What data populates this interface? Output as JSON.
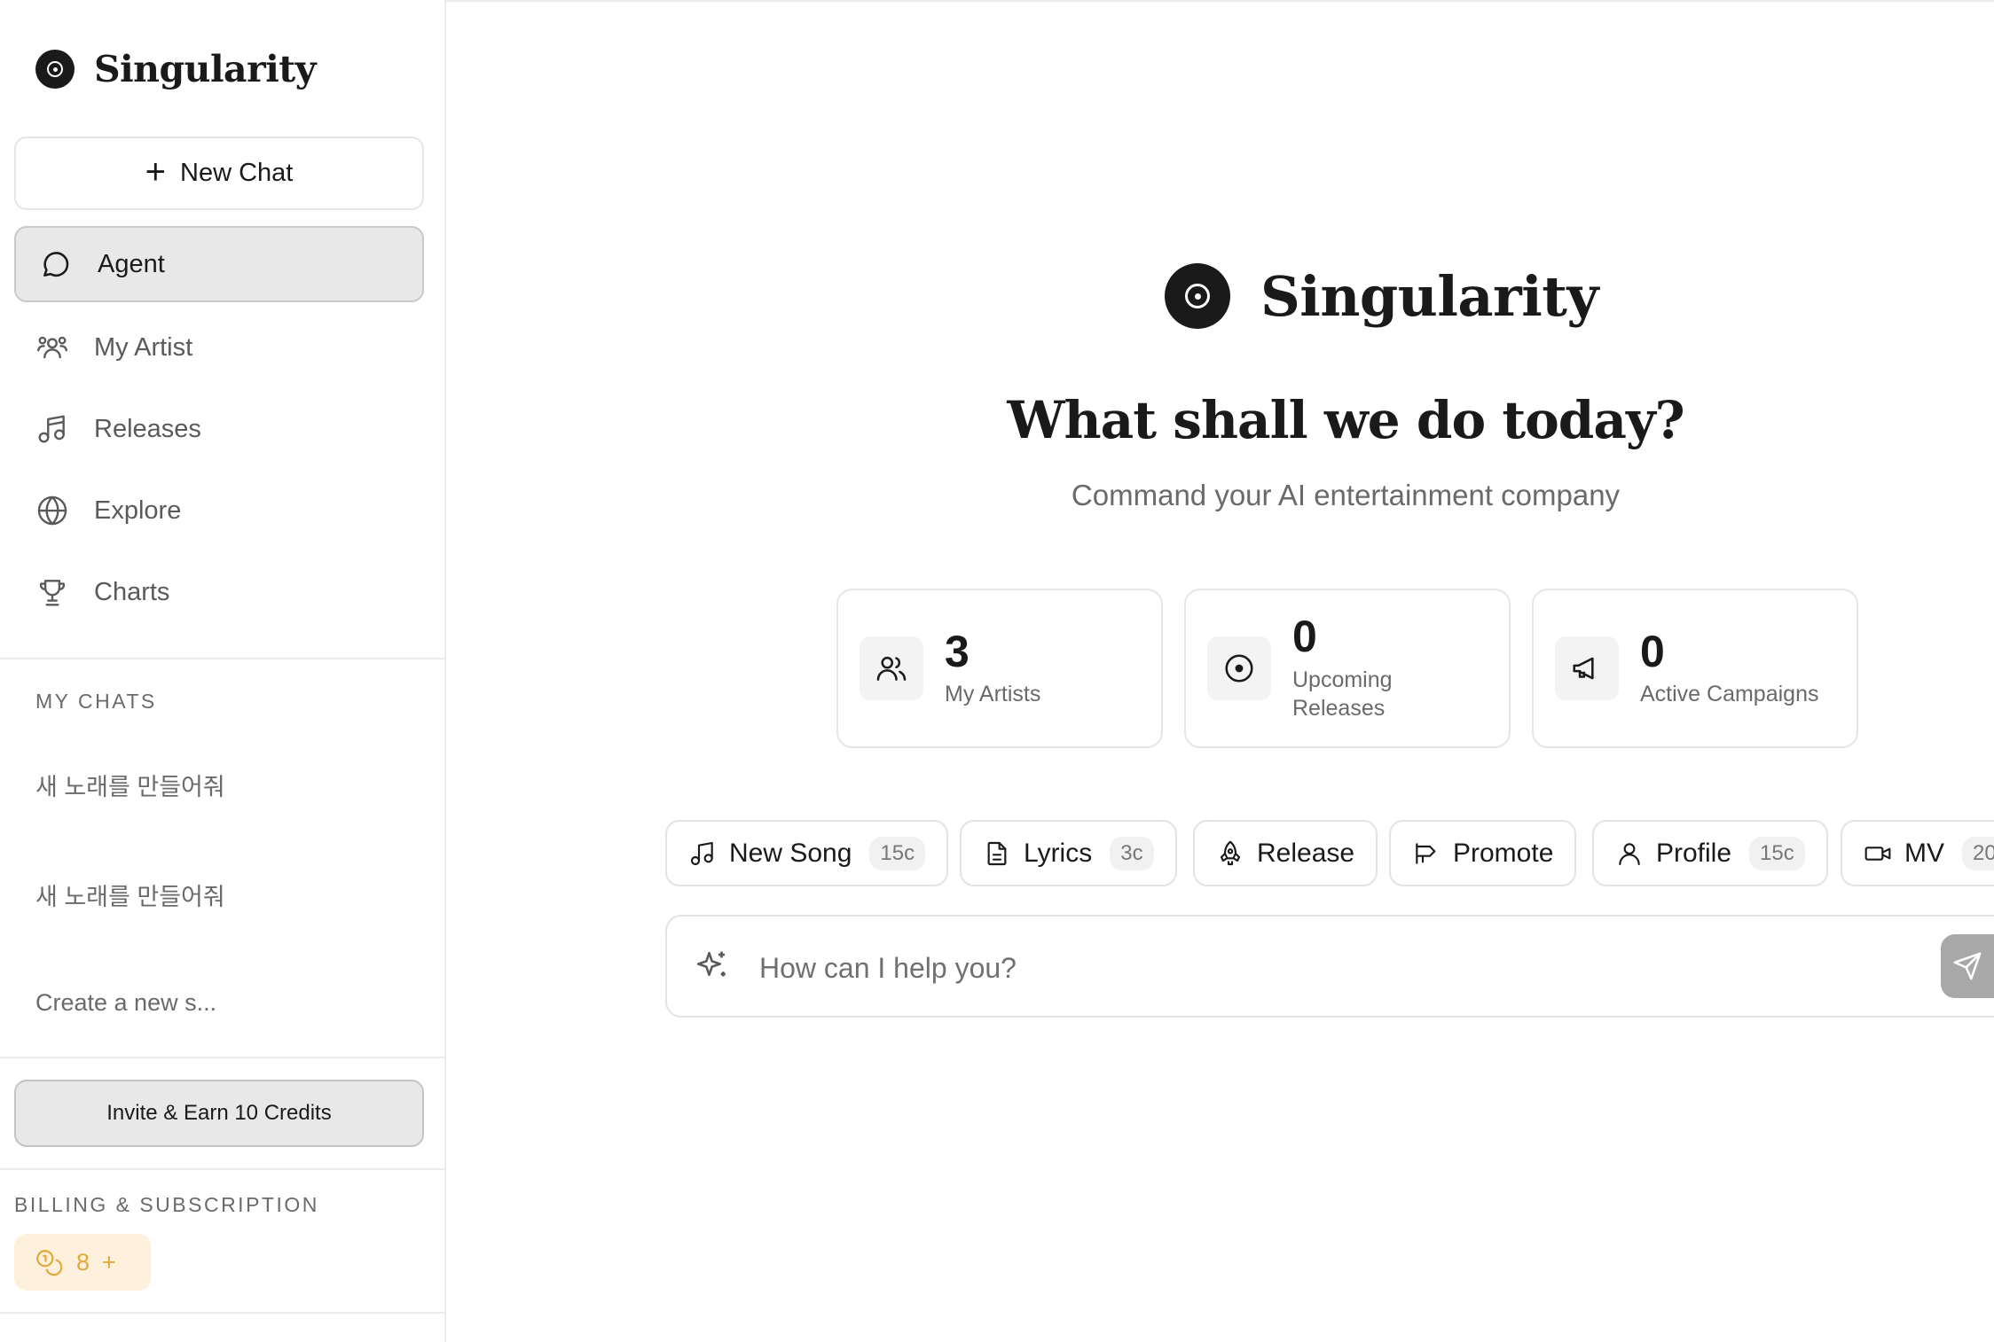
{
  "app": {
    "name": "Singularity"
  },
  "sidebar": {
    "new_chat_label": "New Chat",
    "nav": [
      {
        "label": "Agent",
        "icon": "chat-bubble-icon",
        "active": true
      },
      {
        "label": "My Artist",
        "icon": "users-icon"
      },
      {
        "label": "Releases",
        "icon": "music-note-icon"
      },
      {
        "label": "Explore",
        "icon": "globe-icon"
      },
      {
        "label": "Charts",
        "icon": "trophy-icon"
      }
    ],
    "my_chats_title": "MY CHATS",
    "chats": [
      "새 노래를 만들어줘",
      "새 노래를 만들어줘",
      "Create a new s..."
    ],
    "invite_label": "Invite & Earn 10 Credits",
    "billing_title": "BILLING & SUBSCRIPTION",
    "credits": {
      "value": "8",
      "add": "+",
      "color": "#e3a93a"
    }
  },
  "main": {
    "headline": "What shall we do today?",
    "subheadline": "Command your AI entertainment company",
    "stats": [
      {
        "value": "3",
        "label": "My Artists",
        "icon": "users-icon"
      },
      {
        "value": "0",
        "label": "Upcoming Releases",
        "icon": "disc-icon"
      },
      {
        "value": "0",
        "label": "Active Campaigns",
        "icon": "megaphone-icon"
      }
    ],
    "actions": [
      {
        "label": "New Song",
        "cost": "15c",
        "icon": "music-note-icon"
      },
      {
        "label": "Lyrics",
        "cost": "3c",
        "icon": "document-icon"
      },
      {
        "label": "Release",
        "cost": "",
        "icon": "rocket-icon"
      },
      {
        "label": "Promote",
        "cost": "",
        "icon": "megaphone-icon"
      },
      {
        "label": "Profile",
        "cost": "15c",
        "icon": "user-icon"
      },
      {
        "label": "MV",
        "cost": "20",
        "icon": "video-icon"
      }
    ],
    "prompt": {
      "placeholder": "How can I help you?"
    }
  }
}
